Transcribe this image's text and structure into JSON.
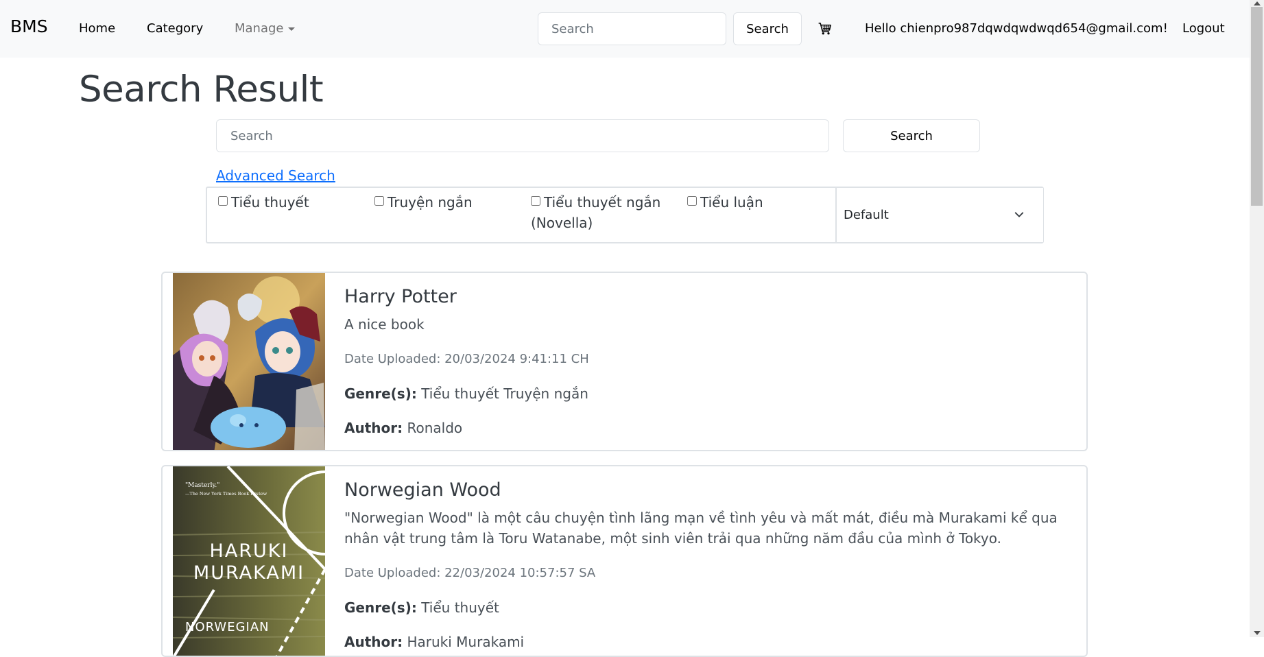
{
  "navbar": {
    "brand": "BMS",
    "links": [
      "Home",
      "Category",
      "Manage"
    ],
    "search_placeholder": "Search",
    "search_button": "Search",
    "greeting": "Hello chienpro987dqwdqwdwqd654@gmail.com!",
    "logout": "Logout"
  },
  "page": {
    "title": "Search Result",
    "search_placeholder": "Search",
    "search_button": "Search",
    "advanced_search": "Advanced Search"
  },
  "filters": {
    "genres": [
      {
        "label": "Tiểu thuyết",
        "checked": false
      },
      {
        "label": "Truyện ngắn",
        "checked": false
      },
      {
        "label": "Tiểu thuyết ngắn (Novella)",
        "checked": false
      },
      {
        "label": "Tiểu luận",
        "checked": false
      }
    ],
    "sort_selected": "Default"
  },
  "labels": {
    "genres": "Genre(s):",
    "author": "Author:"
  },
  "books": [
    {
      "title": "Harry Potter",
      "description": "A nice book",
      "date": "Date Uploaded: 20/03/2024 9:41:11 CH",
      "genres": "Tiểu thuyết Truyện ngắn",
      "author": "Ronaldo"
    },
    {
      "title": "Norwegian Wood",
      "description": "\"Norwegian Wood\" là một câu chuyện tình lãng mạn về tình yêu và mất mát, điều mà Murakami kể qua nhân vật trung tâm là Toru Watanabe, một sinh viên trải qua những năm đầu của mình ở Tokyo.",
      "date": "Date Uploaded: 22/03/2024 10:57:57 SA",
      "genres": "Tiểu thuyết",
      "author": "Haruki Murakami",
      "cover": {
        "quote": "\"Masterly.\"",
        "quote_source": "—The New York Times Book Review",
        "author_line1": "HARUKI",
        "author_line2": "MURAKAMI",
        "title_line": "NORWEGIAN"
      }
    }
  ],
  "colors": {
    "navbar_bg": "#f8f9fa",
    "link": "#0d6efd",
    "border": "#dee2e6"
  }
}
